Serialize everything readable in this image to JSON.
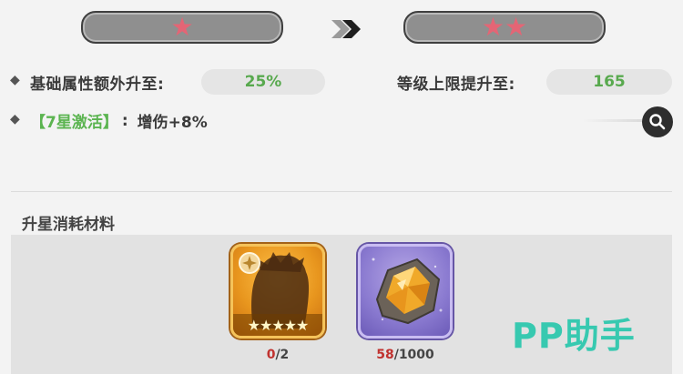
{
  "star_upgrade": {
    "current_stars": 1,
    "next_stars": 2,
    "current_stars_text": "★",
    "next_stars_text": "★★",
    "star_color": "#e46575"
  },
  "stats": {
    "base_attr_label": "基础属性额外升至:",
    "base_attr_value": "25%",
    "level_cap_label": "等级上限提升至:",
    "level_cap_value": "165",
    "value_color": "#58a94e"
  },
  "activation": {
    "tag": "【7星激活】",
    "colon": ":",
    "effect": "增伤+8%"
  },
  "materials": {
    "title": "升星消耗材料",
    "items": [
      {
        "icon": "character-shard-icon",
        "stars_text": "★★★★★",
        "have": "0",
        "need": "/2"
      },
      {
        "icon": "amber-ore-icon",
        "have": "58",
        "need": "/1000"
      }
    ]
  },
  "watermark": "PP助手"
}
